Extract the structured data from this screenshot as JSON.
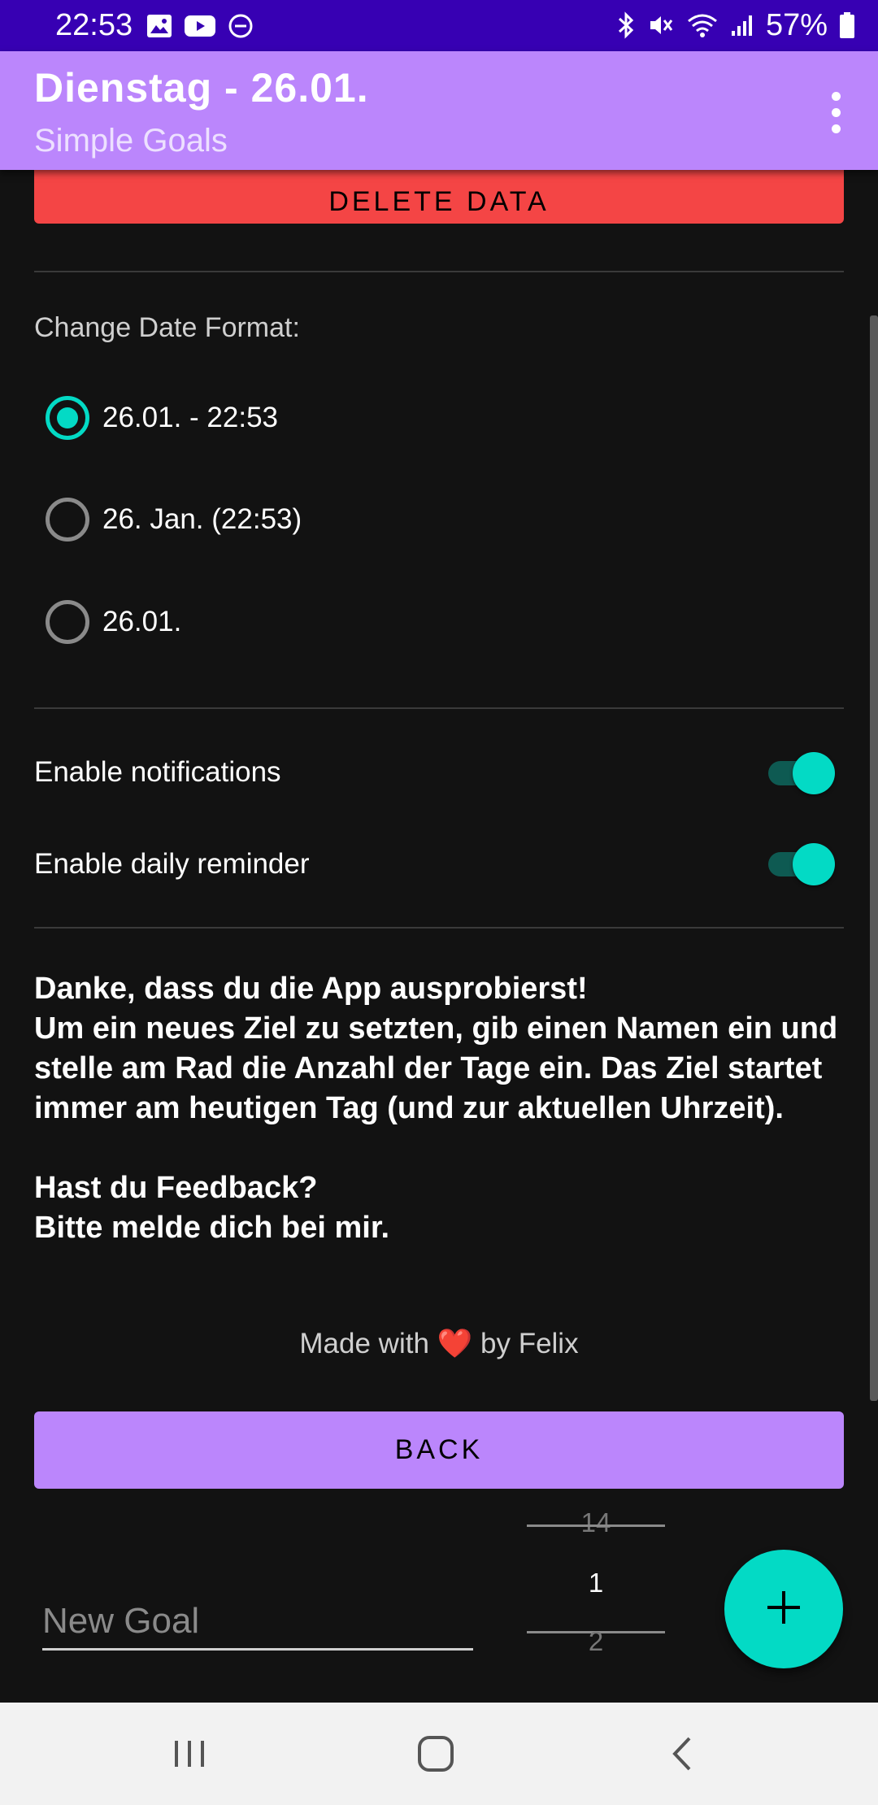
{
  "status_bar": {
    "time": "22:53",
    "battery": "57%",
    "left_icons": [
      "image-icon",
      "youtube-icon",
      "dnd-icon"
    ],
    "right_icons": [
      "bluetooth-icon",
      "mute-icon",
      "wifi-icon",
      "signal-icon",
      "battery-icon"
    ]
  },
  "appbar": {
    "title": "Dienstag - 26.01.",
    "subtitle": "Simple Goals",
    "menu_icon": "more-vert-icon"
  },
  "settings": {
    "delete_label": "DELETE DATA",
    "date_format_label": "Change Date Format:",
    "date_formats": [
      {
        "label": "26.01. - 22:53",
        "selected": true
      },
      {
        "label": "26. Jan. (22:53)",
        "selected": false
      },
      {
        "label": "26.01.",
        "selected": false
      }
    ],
    "toggles": [
      {
        "label": "Enable notifications",
        "on": true
      },
      {
        "label": "Enable daily reminder",
        "on": true
      }
    ]
  },
  "info": {
    "line1": "Danke, dass du die App ausprobierst!",
    "line2": "Um ein neues Ziel zu setzten, gib einen Namen ein und stelle am Rad die Anzahl der Tage ein. Das Ziel startet immer am heutigen Tag (und zur aktuellen Uhrzeit).",
    "line3": "Hast du Feedback?",
    "line4": "Bitte melde dich bei mir.",
    "made_with_prefix": "Made with",
    "made_with_heart": "❤️",
    "made_with_suffix": "by Felix"
  },
  "back_label": "BACK",
  "new_goal": {
    "placeholder": "New Goal",
    "value": ""
  },
  "day_picker": {
    "prev": "14",
    "current": "1",
    "next": "2"
  },
  "fab_icon": "plus-icon",
  "nav": {
    "recents_icon": "recents-icon",
    "home_icon": "home-icon",
    "back_icon": "back-icon"
  },
  "colors": {
    "primary": "#bb86fc",
    "secondary": "#03dac5",
    "status_bar": "#3700b3",
    "danger": "#f44545",
    "background": "#121212"
  }
}
